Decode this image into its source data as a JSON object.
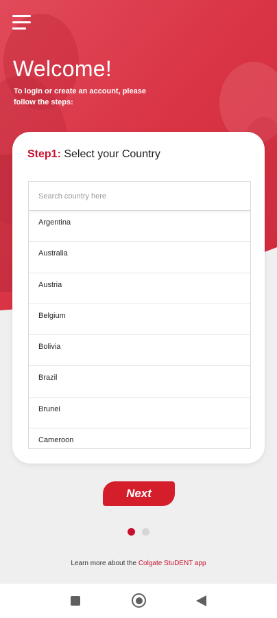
{
  "colors": {
    "brand_red": "#d41e2b",
    "hero_red": "#dc3245",
    "dot_active": "#c8102e",
    "dot_inactive": "#d6d6d6"
  },
  "header": {
    "menu_icon": "hamburger-menu-icon",
    "title": "Welcome!",
    "subtitle": "To login or create an account, please follow the steps:"
  },
  "card": {
    "step_label": "Step1:",
    "step_title": " Select your Country",
    "search_placeholder": "Search country here",
    "search_value": "",
    "countries": [
      "Argentina",
      "Australia",
      "Austria",
      "Belgium",
      "Bolivia",
      "Brazil",
      "Brunei",
      "Cameroon"
    ]
  },
  "next_label": "Next",
  "pager": {
    "total": 2,
    "active": 0
  },
  "footer": {
    "text": "Learn more about the ",
    "link": "Colgate StuDENT app"
  },
  "system_nav": {
    "recents_icon": "square-recents-icon",
    "home_icon": "circle-home-icon",
    "back_icon": "triangle-back-icon"
  }
}
